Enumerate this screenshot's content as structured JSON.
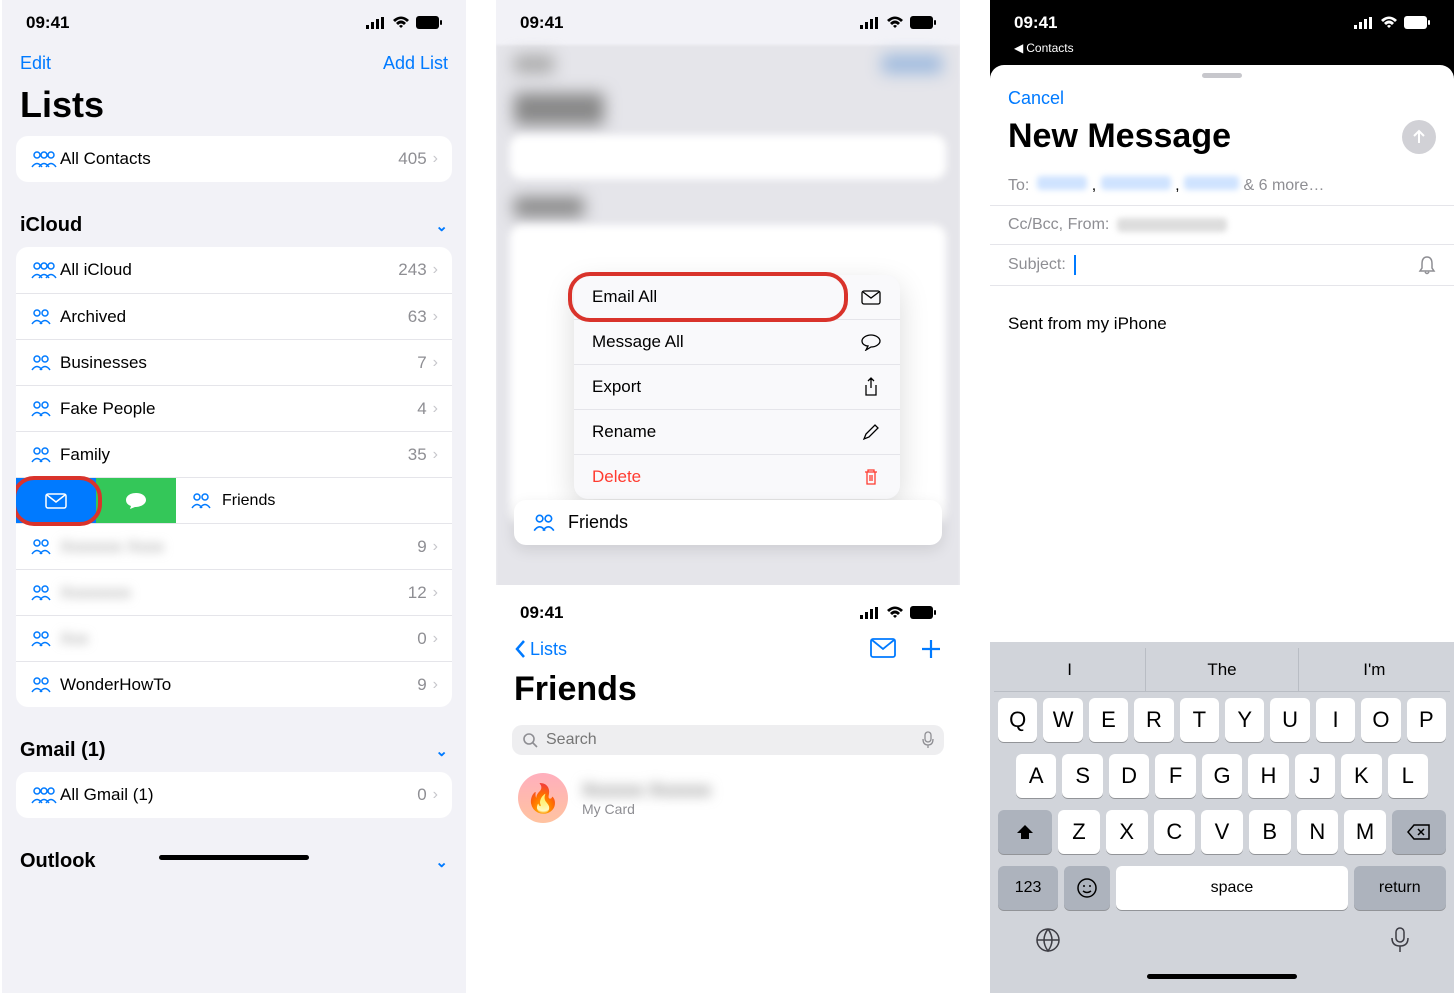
{
  "time": "09:41",
  "screen1": {
    "edit": "Edit",
    "addlist": "Add List",
    "title": "Lists",
    "allcontacts": {
      "label": "All Contacts",
      "count": "405"
    },
    "sections": {
      "icloud": {
        "header": "iCloud",
        "rows": [
          {
            "label": "All iCloud",
            "count": "243",
            "triple": true
          },
          {
            "label": "Archived",
            "count": "63"
          },
          {
            "label": "Businesses",
            "count": "7"
          },
          {
            "label": "Fake People",
            "count": "4"
          },
          {
            "label": "Family",
            "count": "35"
          }
        ],
        "friends_label": "Friends",
        "blurred": [
          {
            "count": "9"
          },
          {
            "count": "12"
          },
          {
            "count": "0"
          }
        ],
        "last": {
          "label": "WonderHowTo",
          "count": "9"
        }
      },
      "gmail": {
        "header": "Gmail (1)",
        "row": {
          "label": "All Gmail (1)",
          "count": "0"
        }
      },
      "outlook": {
        "header": "Outlook"
      }
    }
  },
  "screen2": {
    "menu": {
      "email": "Email All",
      "message": "Message All",
      "export": "Export",
      "rename": "Rename",
      "delete": "Delete"
    },
    "pill": "Friends",
    "lower": {
      "back": "Lists",
      "title": "Friends",
      "search": "Search",
      "mycard": "My Card"
    }
  },
  "screen3": {
    "back_app": "Contacts",
    "cancel": "Cancel",
    "title": "New Message",
    "to_label": "To:",
    "to_more": "& 6 more…",
    "cc_label": "Cc/Bcc, From:",
    "subject_label": "Subject:",
    "body": "Sent from my iPhone",
    "suggest": [
      "I",
      "The",
      "I'm"
    ],
    "keys_r1": [
      "Q",
      "W",
      "E",
      "R",
      "T",
      "Y",
      "U",
      "I",
      "O",
      "P"
    ],
    "keys_r2": [
      "A",
      "S",
      "D",
      "F",
      "G",
      "H",
      "J",
      "K",
      "L"
    ],
    "keys_r3": [
      "Z",
      "X",
      "C",
      "V",
      "B",
      "N",
      "M"
    ],
    "num": "123",
    "space": "space",
    "return": "return"
  }
}
